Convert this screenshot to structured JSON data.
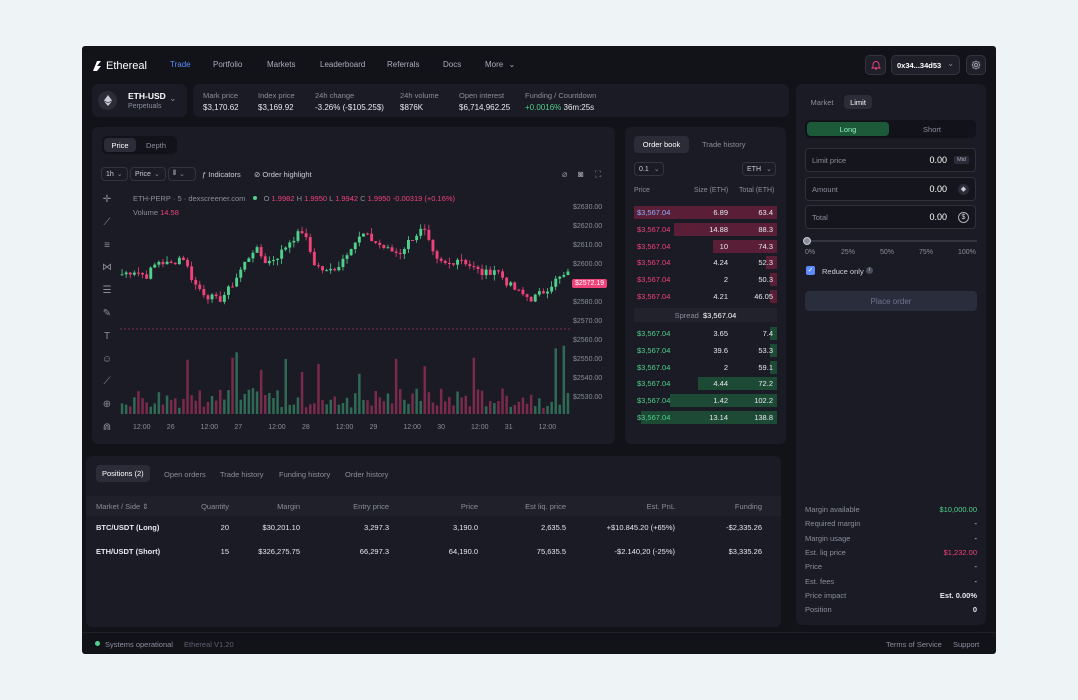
{
  "app": {
    "name": "Ethereal"
  },
  "nav": {
    "items": [
      "Trade",
      "Portfolio",
      "Markets",
      "Leaderboard",
      "Referrals",
      "Docs",
      "More"
    ]
  },
  "wallet": {
    "address": "0x34...34d53"
  },
  "market": {
    "pair": "ETH-USD",
    "type": "Perpetuals"
  },
  "stats": [
    {
      "label": "Mark price",
      "value": "$3,170.62"
    },
    {
      "label": "Index price",
      "value": "$3,169.92"
    },
    {
      "label": "24h change",
      "value": "-3.26% (-$105.25$)"
    },
    {
      "label": "24h volume",
      "value": "$876K"
    },
    {
      "label": "Open interest",
      "value": "$6,714,962.25"
    },
    {
      "label": "Funding / Countdown",
      "value_rate": "+0.0016%",
      "value_time": "36m:25s"
    }
  ],
  "chart": {
    "tabs": [
      "Price",
      "Depth"
    ],
    "toolbar": {
      "interval": "1h",
      "type": "Price",
      "indicators": "Indicators",
      "highlight": "Order highlight"
    },
    "legend": {
      "symbol": "ETH-PERP",
      "interval": "5",
      "source": "dexscreener.com",
      "o": "1.9982",
      "h": "1.9950",
      "l": "1.9942",
      "c": "1.9950",
      "chg": "-0.00319 (+0.16%)",
      "volume_label": "Volume",
      "volume": "14.58"
    },
    "current_price_label": "$2572.19"
  },
  "chart_data": {
    "type": "candlestick",
    "y_axis": [
      "$2630.00",
      "$2620.00",
      "$2610.00",
      "$2600.00",
      "$2590.00",
      "$2580.00",
      "$2570.00",
      "$2560.00",
      "$2550.00",
      "$2540.00",
      "$2530.00"
    ],
    "x_axis": [
      "12:00",
      "26",
      "12:00",
      "27",
      "12:00",
      "28",
      "12:00",
      "29",
      "12:00",
      "30",
      "12:00",
      "31",
      "12:00"
    ],
    "ylim": [
      2530,
      2630
    ],
    "current_price": 2572.19
  },
  "orderbook": {
    "tabs": [
      "Order book",
      "Trade history"
    ],
    "tick": "0.1",
    "unit": "ETH",
    "headers": [
      "Price",
      "Size (ETH)",
      "Total (ETH)"
    ],
    "asks": [
      {
        "price": "$3,567.04",
        "size": "6.89",
        "total": "63.4",
        "depth": 1.0
      },
      {
        "price": "$3,567.04",
        "size": "14.88",
        "total": "88.3",
        "depth": 0.72
      },
      {
        "price": "$3,567.04",
        "size": "10",
        "total": "74.3",
        "depth": 0.45
      },
      {
        "price": "$3,567.04",
        "size": "4.24",
        "total": "52.3",
        "depth": 0.08
      },
      {
        "price": "$3,567.04",
        "size": "2",
        "total": "50.3",
        "depth": 0.05
      },
      {
        "price": "$3,567.04",
        "size": "4.21",
        "total": "46.05",
        "depth": 0.05
      }
    ],
    "spread_label": "Spread",
    "spread_value": "$3,567.04",
    "bids": [
      {
        "price": "$3,567.04",
        "size": "3.65",
        "total": "7.4",
        "depth": 0.05
      },
      {
        "price": "$3,567.04",
        "size": "39.6",
        "total": "53.3",
        "depth": 0.05
      },
      {
        "price": "$3,567.04",
        "size": "2",
        "total": "59.1",
        "depth": 0.05
      },
      {
        "price": "$3,567.04",
        "size": "4.44",
        "total": "72.2",
        "depth": 0.55
      },
      {
        "price": "$3,567.04",
        "size": "1.42",
        "total": "102.2",
        "depth": 0.75
      },
      {
        "price": "$3,567.04",
        "size": "13.14",
        "total": "138.8",
        "depth": 0.95
      }
    ]
  },
  "positions": {
    "tabs": [
      "Positions (2)",
      "Open orders",
      "Trade history",
      "Funding history",
      "Order history"
    ],
    "headers": [
      "Market / Side",
      "Quantity",
      "Margin",
      "Entry price",
      "Price",
      "Est liq. price",
      "Est. PnL",
      "Funding"
    ],
    "rows": [
      {
        "market": "BTC/USDT (Long)",
        "qty": "20",
        "margin": "$30,201.10",
        "entry": "3,297.3",
        "price": "3,190.0",
        "liq": "2,635.5",
        "pnl": "+$10.845.20 (+65%)",
        "funding": "-$2,335.26"
      },
      {
        "market": "ETH/USDT (Short)",
        "qty": "15",
        "margin": "$326,275.75",
        "entry": "66,297.3",
        "price": "64,190.0",
        "liq": "75,635.5",
        "pnl": "-$2.140,20 (-25%)",
        "funding": "$3,335.26"
      }
    ]
  },
  "order_form": {
    "types": [
      "Market",
      "Limit"
    ],
    "sides": [
      "Long",
      "Short"
    ],
    "limit_price": {
      "label": "Limit price",
      "value": "0.00",
      "badge": "Mid"
    },
    "amount": {
      "label": "Amount",
      "value": "0.00"
    },
    "total": {
      "label": "Total",
      "value": "0.00"
    },
    "slider_marks": [
      "0%",
      "25%",
      "50%",
      "75%",
      "100%"
    ],
    "reduce_only": "Reduce only",
    "submit": "Place order"
  },
  "account": [
    {
      "k": "Margin available",
      "v": "$10,000.00"
    },
    {
      "k": "Required margin",
      "v": "-"
    },
    {
      "k": "Margin usage",
      "v": "-"
    },
    {
      "k": "Est. liq price",
      "v": "$1,232.00"
    },
    {
      "k": "Price",
      "v": "-"
    },
    {
      "k": "Est. fees",
      "v": "-"
    },
    {
      "k": "Price impact",
      "v": "Est. 0.00%"
    },
    {
      "k": "Position",
      "v": "0"
    }
  ],
  "footer": {
    "status": "Systems operational",
    "version": "Ethereal V1.20",
    "terms": "Terms of Service",
    "support": "Support"
  },
  "colors": {
    "bg": "#121219",
    "panel": "#1b1b25",
    "up": "#4fd18b",
    "down": "#f0427a",
    "accent": "#5b8bff"
  }
}
